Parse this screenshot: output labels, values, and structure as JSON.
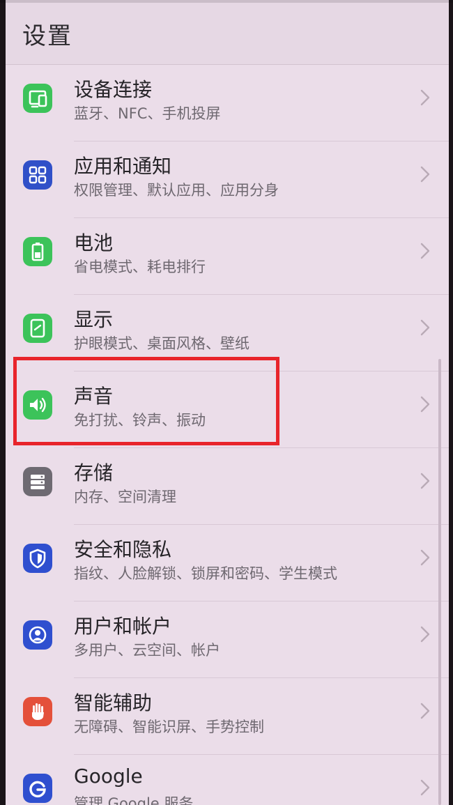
{
  "header": {
    "title": "设置"
  },
  "items": [
    {
      "title": "设备连接",
      "subtitle": "蓝牙、NFC、手机投屏",
      "icon": "device-connection-icon",
      "color": "#3cc35a"
    },
    {
      "title": "应用和通知",
      "subtitle": "权限管理、默认应用、应用分身",
      "icon": "apps-grid-icon",
      "color": "#3050c8"
    },
    {
      "title": "电池",
      "subtitle": "省电模式、耗电排行",
      "icon": "battery-icon",
      "color": "#3cc35a"
    },
    {
      "title": "显示",
      "subtitle": "护眼模式、桌面风格、壁纸",
      "icon": "display-icon",
      "color": "#3cc35a"
    },
    {
      "title": "声音",
      "subtitle": "免打扰、铃声、振动",
      "icon": "speaker-icon",
      "color": "#3cc35a"
    },
    {
      "title": "存储",
      "subtitle": "内存、空间清理",
      "icon": "storage-icon",
      "color": "#6e6a72"
    },
    {
      "title": "安全和隐私",
      "subtitle": "指纹、人脸解锁、锁屏和密码、学生模式",
      "icon": "shield-icon",
      "color": "#2f4fcf"
    },
    {
      "title": "用户和帐户",
      "subtitle": "多用户、云空间、帐户",
      "icon": "user-account-icon",
      "color": "#2f4fcf"
    },
    {
      "title": "智能辅助",
      "subtitle": "无障碍、智能识屏、手势控制",
      "icon": "hand-icon",
      "color": "#e4503a"
    },
    {
      "title": "Google",
      "subtitle": "管理 Google 服务",
      "icon": "google-icon",
      "color": "#2f4fcf"
    }
  ]
}
